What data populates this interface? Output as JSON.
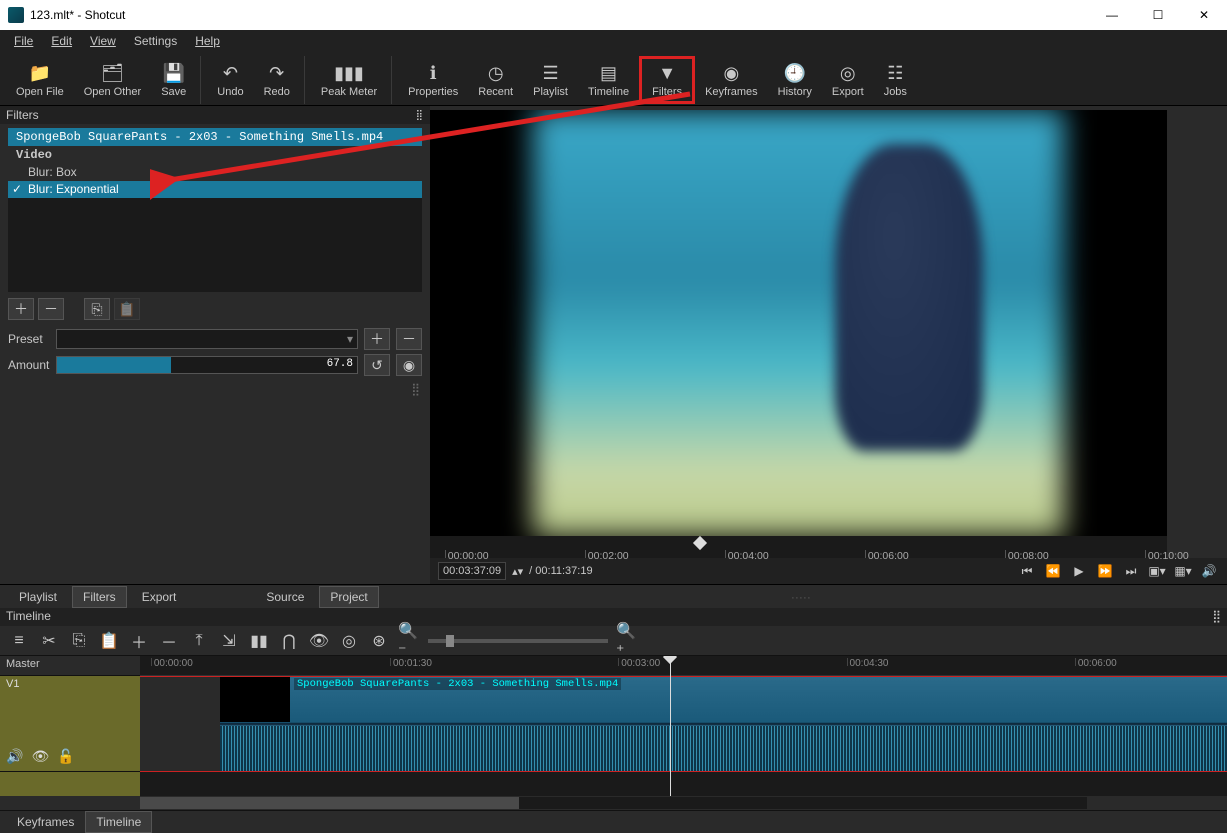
{
  "window": {
    "title": "123.mlt* - Shotcut"
  },
  "menu": {
    "file": "File",
    "edit": "Edit",
    "view": "View",
    "settings": "Settings",
    "help": "Help"
  },
  "toolbar": {
    "open_file": "Open File",
    "open_other": "Open Other",
    "save": "Save",
    "undo": "Undo",
    "redo": "Redo",
    "peak_meter": "Peak Meter",
    "properties": "Properties",
    "recent": "Recent",
    "playlist": "Playlist",
    "timeline": "Timeline",
    "filters": "Filters",
    "keyframes": "Keyframes",
    "history": "History",
    "export": "Export",
    "jobs": "Jobs"
  },
  "filters_panel": {
    "title": "Filters",
    "clip_name": "SpongeBob SquarePants - 2x03 - Something Smells.mp4",
    "group": "Video",
    "items": [
      {
        "checked": false,
        "label": "Blur: Box"
      },
      {
        "checked": true,
        "label": "Blur: Exponential"
      }
    ],
    "preset_label": "Preset",
    "amount_label": "Amount",
    "amount_value": "67.8",
    "amount_percent": 38
  },
  "preview": {
    "ruler": [
      "00:00:00",
      "00:02:00",
      "00:04:00",
      "00:06:00",
      "00:08:00",
      "00:10:00"
    ],
    "current_tc": "00:03:37:09",
    "total_tc": "/ 00:11:37:19"
  },
  "mid_tabs": {
    "playlist": "Playlist",
    "filters": "Filters",
    "export": "Export",
    "source": "Source",
    "project": "Project"
  },
  "timeline": {
    "title": "Timeline",
    "ruler": [
      "00:00:00",
      "00:01:30",
      "00:03:00",
      "00:04:30",
      "00:06:00"
    ],
    "master": "Master",
    "v1": "V1",
    "clip_label": "SpongeBob SquarePants - 2x03 - Something Smells.mp4"
  },
  "bottom_tabs": {
    "keyframes": "Keyframes",
    "timeline": "Timeline"
  }
}
